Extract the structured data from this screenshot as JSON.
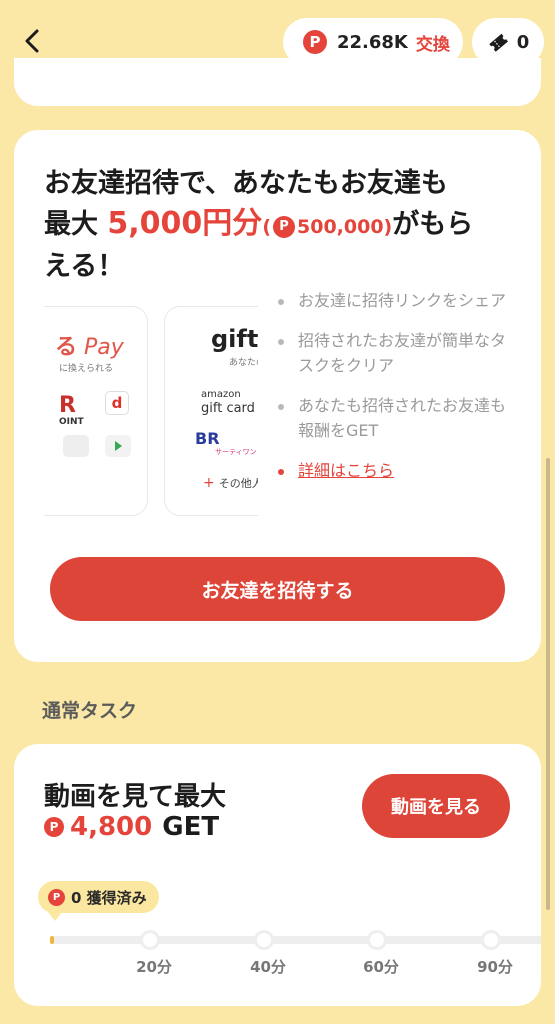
{
  "header": {
    "back_icon": "chevron-left-icon",
    "points_icon": "P",
    "points_value": "22.68K",
    "exchange_label": "交換",
    "ticket_icon": "ticket-icon",
    "ticket_count": "0"
  },
  "invite": {
    "title_line1": "お友達招待で、あなたもお友達も",
    "title_prefix": "最大",
    "amount": "5,000円分",
    "paren_open": "(",
    "coin": "P",
    "points": "500,000",
    "paren_close": ")",
    "title_suffix": "がもら",
    "title_line3": "える！",
    "promo_cards": {
      "pay_brand": "Pay",
      "pay_prefix": "る",
      "pay_caption": "に換えられる",
      "r_logo": "R",
      "r_caption": "OINT",
      "d_logo": "d",
      "gift_brand": "gifte",
      "gift_caption": "あなたの",
      "amazon": "amazon",
      "gift_card": "gift card",
      "br_logo": "BR",
      "br_caption": "サーティワン",
      "other": "その他人!"
    },
    "steps": [
      "お友達に招待リンクをシェア",
      "招待されたお友達が簡単なタスクをクリア",
      "あなたも招待されたお友達も報酬をGET"
    ],
    "detail_link": "詳細はこちら",
    "invite_button": "お友達を招待する"
  },
  "normal_tasks": {
    "section_title": "通常タスク",
    "task": {
      "title": "動画を見て最大",
      "coin": "P",
      "amount": "4,800",
      "get": "GET",
      "watch_button": "動画を見る",
      "earned_coin": "P",
      "earned_label": "0 獲得済み",
      "progress_fraction": 0.0,
      "milestones": [
        "20分",
        "40分",
        "60分",
        "90分"
      ]
    }
  },
  "colors": {
    "background": "#fbe7a6",
    "accent": "#dc4538",
    "coin": "#e4443a",
    "badge": "#fce7a0"
  }
}
